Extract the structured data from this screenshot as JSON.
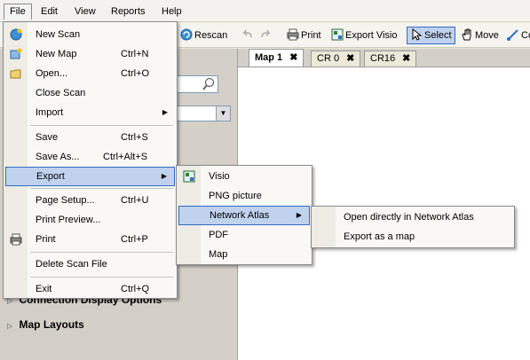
{
  "menubar": {
    "items": [
      "File",
      "Edit",
      "View",
      "Reports",
      "Help"
    ]
  },
  "toolbar": {
    "rescan": "Rescan",
    "print": "Print",
    "export_visio": "Export Visio",
    "select": "Select",
    "move": "Move",
    "connect": "Co"
  },
  "tabs": [
    {
      "label": "Map 1",
      "close": "✖"
    },
    {
      "label": "CR 0",
      "close": "✖"
    },
    {
      "label": "CR16",
      "close": "✖"
    }
  ],
  "left_sections": {
    "connection": "Connection Display Options",
    "map_layouts": "Map Layouts"
  },
  "file_menu": {
    "items": [
      {
        "label": "New Scan",
        "shortcut": ""
      },
      {
        "label": "New Map",
        "shortcut": "Ctrl+N"
      },
      {
        "label": "Open...",
        "shortcut": "Ctrl+O"
      },
      {
        "label": "Close Scan",
        "shortcut": ""
      },
      {
        "label": "Import",
        "shortcut": ""
      },
      {
        "label": "Save",
        "shortcut": "Ctrl+S"
      },
      {
        "label": "Save As...",
        "shortcut": "Ctrl+Alt+S"
      },
      {
        "label": "Export",
        "shortcut": ""
      },
      {
        "label": "Page Setup...",
        "shortcut": "Ctrl+U"
      },
      {
        "label": "Print Preview...",
        "shortcut": ""
      },
      {
        "label": "Print",
        "shortcut": "Ctrl+P"
      },
      {
        "label": "Delete Scan File",
        "shortcut": ""
      },
      {
        "label": "Exit",
        "shortcut": "Ctrl+Q"
      }
    ]
  },
  "export_menu": {
    "items": [
      "Visio",
      "PNG picture",
      "Network Atlas",
      "PDF",
      "Map"
    ]
  },
  "atlas_menu": {
    "items": [
      "Open directly in Network Atlas",
      "Export as a map"
    ]
  },
  "colors": {
    "highlight": "#c1d2ee",
    "highlight_border": "#316ac5"
  }
}
